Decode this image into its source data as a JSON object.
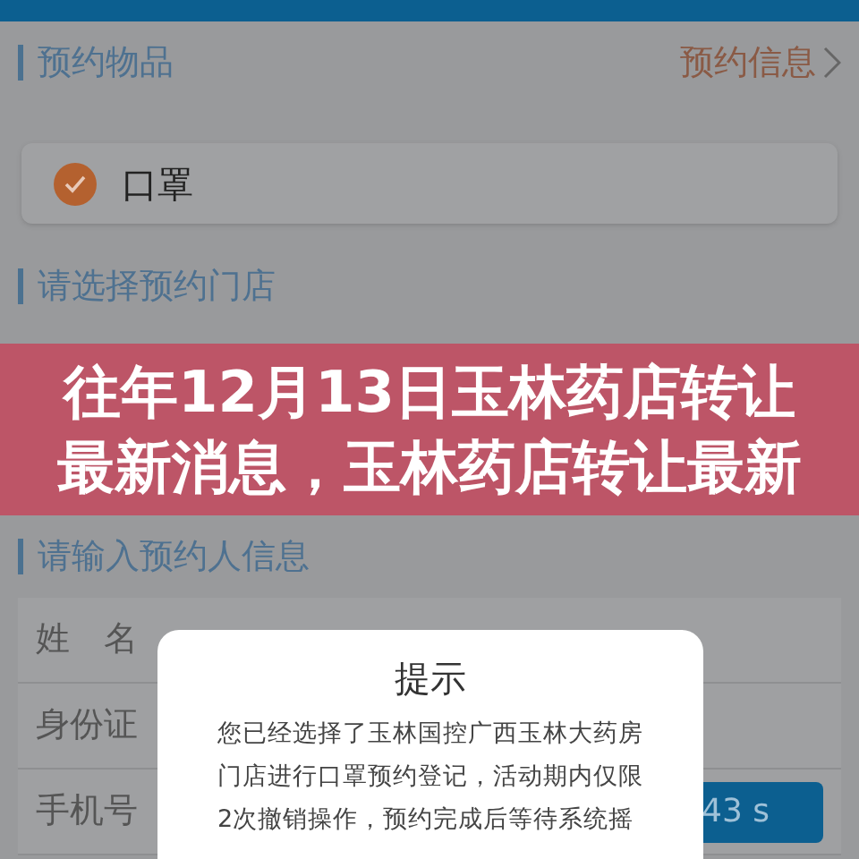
{
  "sections": [
    {
      "title": "预约物品",
      "link": "预约信息"
    },
    {
      "title": "请选择预约门店"
    },
    {
      "title": "请输入预约人信息"
    }
  ],
  "item": {
    "label": "口罩",
    "checked": true
  },
  "banner": {
    "lines": [
      "往年12月13日玉林药店转让",
      "最新消息，玉林药店转让最新"
    ]
  },
  "form": [
    {
      "label": "姓　名"
    },
    {
      "label": "身份证"
    },
    {
      "label": "手机号",
      "button": "43 s"
    }
  ],
  "dialog": {
    "title": "提示",
    "lines": [
      "您已经选择了玉林国控广西玉林大药房",
      "门店进行口罩预约登记，活动期内仅限",
      "2次撤销操作，预约完成后等待系统摇"
    ]
  }
}
